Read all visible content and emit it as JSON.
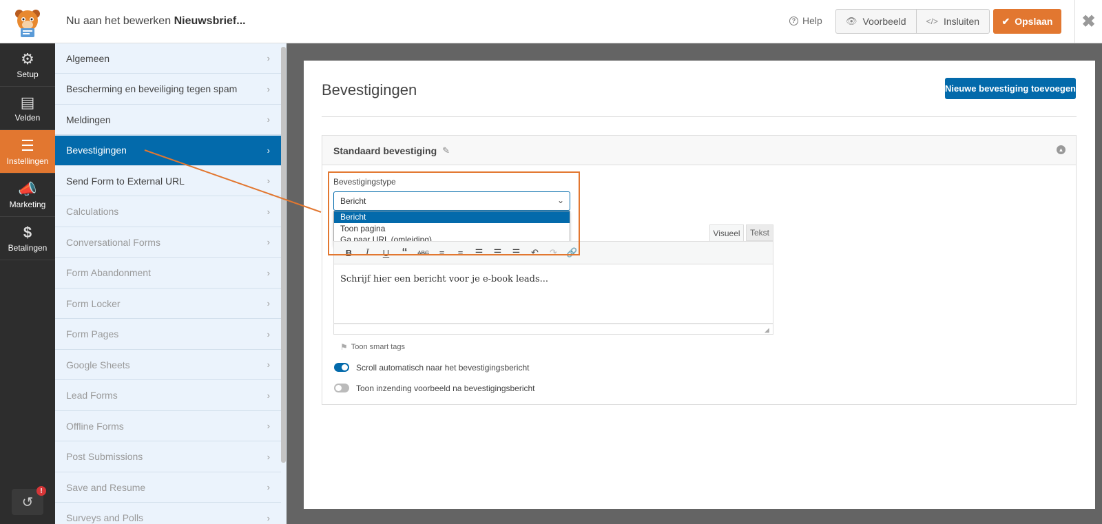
{
  "header": {
    "editing_prefix": "Nu aan het bewerken",
    "form_name": "Nieuwsbrief...",
    "help": "Help",
    "preview": "Voorbeeld",
    "embed": "Insluiten",
    "save": "Opslaan"
  },
  "leftnav": {
    "items": [
      {
        "label": "Setup",
        "icon": "gear-icon"
      },
      {
        "label": "Velden",
        "icon": "list-icon"
      },
      {
        "label": "Instellingen",
        "icon": "sliders-icon"
      },
      {
        "label": "Marketing",
        "icon": "megaphone-icon"
      },
      {
        "label": "Betalingen",
        "icon": "dollar-icon"
      }
    ],
    "revisions_badge": "!"
  },
  "settings": {
    "items": [
      {
        "label": "Algemeen",
        "state": "normal"
      },
      {
        "label": "Bescherming en beveiliging tegen spam",
        "state": "normal"
      },
      {
        "label": "Meldingen",
        "state": "normal"
      },
      {
        "label": "Bevestigingen",
        "state": "active"
      },
      {
        "label": "Send Form to External URL",
        "state": "normal"
      },
      {
        "label": "Calculations",
        "state": "disabled"
      },
      {
        "label": "Conversational Forms",
        "state": "disabled"
      },
      {
        "label": "Form Abandonment",
        "state": "disabled"
      },
      {
        "label": "Form Locker",
        "state": "disabled"
      },
      {
        "label": "Form Pages",
        "state": "disabled"
      },
      {
        "label": "Google Sheets",
        "state": "disabled"
      },
      {
        "label": "Lead Forms",
        "state": "disabled"
      },
      {
        "label": "Offline Forms",
        "state": "disabled"
      },
      {
        "label": "Post Submissions",
        "state": "disabled"
      },
      {
        "label": "Save and Resume",
        "state": "disabled"
      },
      {
        "label": "Surveys and Polls",
        "state": "disabled"
      }
    ]
  },
  "main": {
    "title": "Bevestigingen",
    "add_button": "Nieuwe bevestiging toevoegen",
    "confirmation": {
      "title": "Standaard bevestiging",
      "type_label": "Bevestigingstype",
      "type_value": "Bericht",
      "options": [
        "Bericht",
        "Toon pagina",
        "Ga naar URL (omleiding)"
      ],
      "tab_visual": "Visueel",
      "tab_text": "Tekst",
      "message": "Schrijf hier een bericht voor je e-book leads...",
      "smart_tags": "Toon smart tags",
      "toggle_scroll": {
        "label": "Scroll automatisch naar het bevestigingsbericht",
        "on": true
      },
      "toggle_preview": {
        "label": "Toon inzending voorbeeld na bevestigingsbericht",
        "on": false
      }
    }
  },
  "colors": {
    "accent_orange": "#e27730",
    "accent_blue": "#036aab",
    "nav_dark": "#2d2d2d",
    "settings_bg": "#ebf3fc"
  }
}
